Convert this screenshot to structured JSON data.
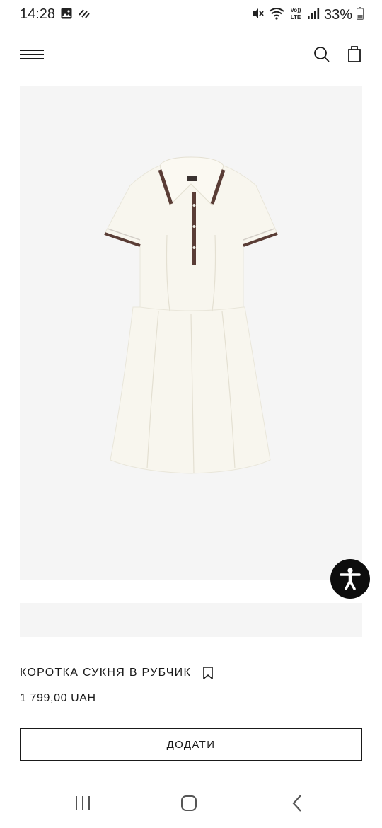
{
  "status_bar": {
    "time": "14:28",
    "battery": "33%",
    "volte_label_top": "Vo))",
    "volte_label_bottom": "LTE",
    "icons": [
      "gallery-icon",
      "flash-icon",
      "mute-icon",
      "wifi-icon",
      "volte-icon",
      "signal-icon",
      "battery-icon"
    ]
  },
  "header": {
    "icons": [
      "menu-icon",
      "search-icon",
      "shopping-bag-icon"
    ]
  },
  "product": {
    "image_label": "white-polo-dress",
    "name": "КОРОТКА СУКНЯ В РУБЧИК",
    "price": "1 799,00 UAH",
    "add_label": "ДОДАТИ"
  },
  "colors": {
    "image_bg": "#f5f5f5",
    "dress": "#f8f6ee",
    "trim": "#5a3d36",
    "fab": "#0d0d0d",
    "text": "#1a1a1a"
  },
  "nav": {
    "icons": [
      "recents-icon",
      "home-icon",
      "back-icon"
    ]
  }
}
